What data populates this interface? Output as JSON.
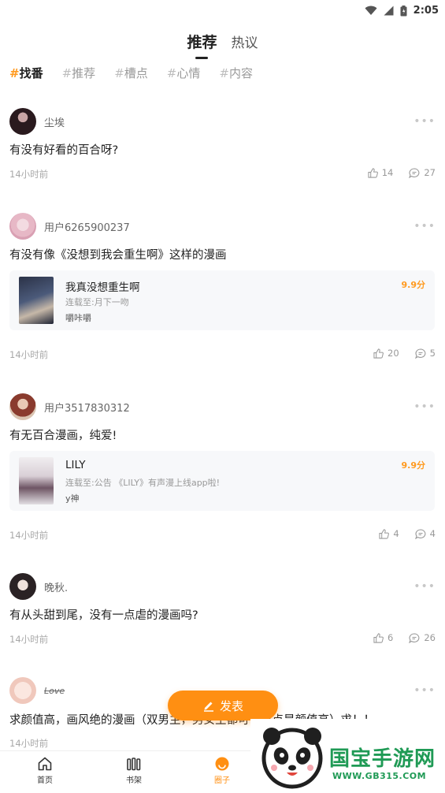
{
  "status_bar": {
    "time": "2:05",
    "icons": [
      "wifi-icon",
      "signal-icon",
      "battery-icon"
    ]
  },
  "top_tabs": [
    {
      "label": "推荐",
      "active": true
    },
    {
      "label": "热议",
      "active": false
    }
  ],
  "topics": [
    {
      "hash": "#",
      "label": "找番",
      "active": true
    },
    {
      "hash": "#",
      "label": "推荐",
      "active": false
    },
    {
      "hash": "#",
      "label": "槽点",
      "active": false
    },
    {
      "hash": "#",
      "label": "心情",
      "active": false
    },
    {
      "hash": "#",
      "label": "内容",
      "active": false
    }
  ],
  "posts": [
    {
      "username": "尘埃",
      "text": "有没有好看的百合呀?",
      "time": "14小时前",
      "likes": "14",
      "comments": "27"
    },
    {
      "username": "用户6265900237",
      "text": "有没有像《没想到我会重生啊》这样的漫画",
      "time": "14小时前",
      "likes": "20",
      "comments": "5",
      "book": {
        "title": "我真没想重生啊",
        "update": "连载至:月下一吻",
        "author": "嚼咔嚼",
        "score": "9.9分"
      }
    },
    {
      "username": "用户3517830312",
      "text": "有无百合漫画，纯爱!",
      "time": "14小时前",
      "likes": "4",
      "comments": "4",
      "book": {
        "title": "LILY",
        "update": "连载至:公告 《LILY》有声漫上线app啦!",
        "author": "y神",
        "score": "9.9分"
      }
    },
    {
      "username": "晚秋.",
      "text": "有从头甜到尾，没有一点虐的漫画吗?",
      "time": "14小时前",
      "likes": "6",
      "comments": "26"
    },
    {
      "username": "Love",
      "text": "求颜值高，画风绝的漫画（双男主，男女主都可，重点是颜值高）求！！",
      "time": "14小时前"
    }
  ],
  "publish_button": {
    "label": "发表"
  },
  "bottom_nav": [
    {
      "label": "首页",
      "icon": "home-icon",
      "active": false
    },
    {
      "label": "书架",
      "icon": "bookshelf-icon",
      "active": false
    },
    {
      "label": "圈子",
      "icon": "circle-icon",
      "active": true
    }
  ],
  "watermark": {
    "text": "国宝手游网",
    "url": "WWW.GB315.COM"
  },
  "colors": {
    "accent": "#ff8f12",
    "watermark": "#1f9a55"
  }
}
